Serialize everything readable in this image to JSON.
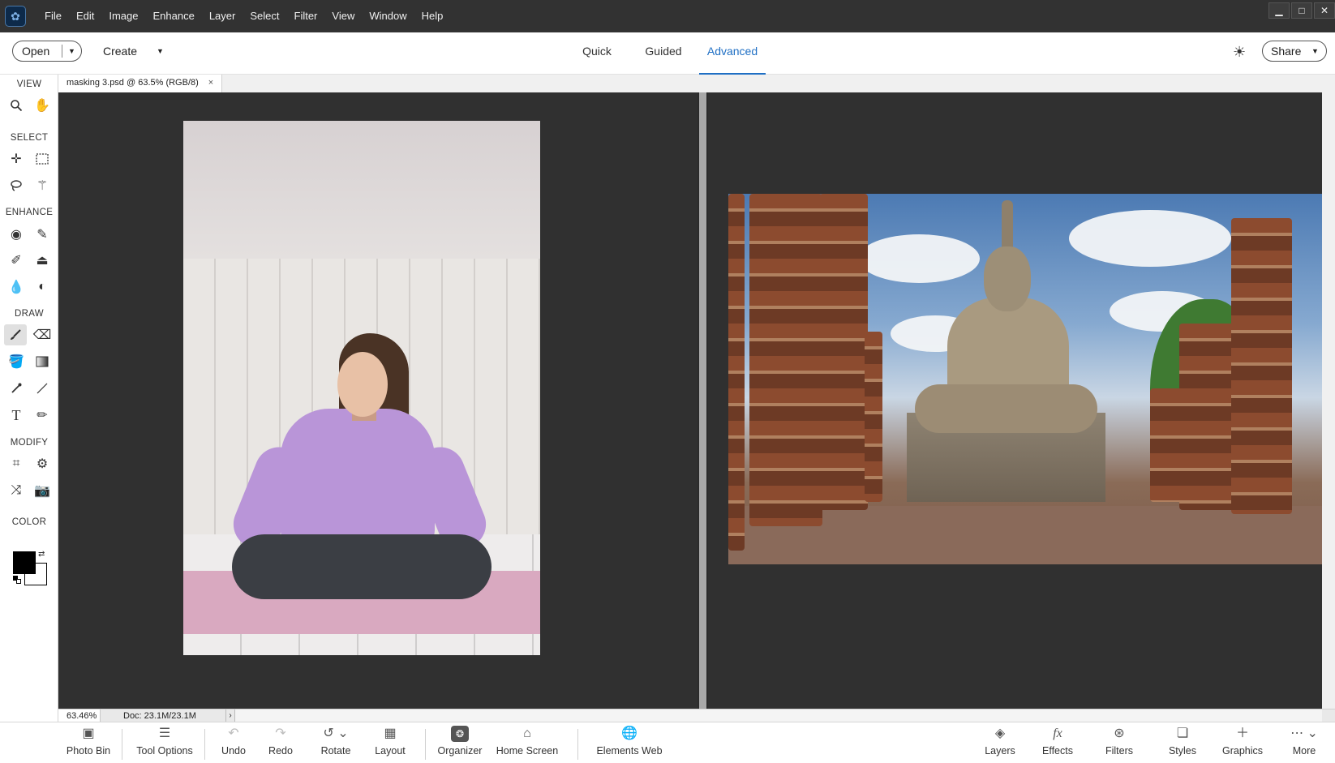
{
  "menubar": {
    "items": [
      "File",
      "Edit",
      "Image",
      "Enhance",
      "Layer",
      "Select",
      "Filter",
      "View",
      "Window",
      "Help"
    ]
  },
  "topbar": {
    "open_label": "Open",
    "create_label": "Create",
    "modes": [
      "Quick",
      "Guided",
      "Advanced"
    ],
    "active_mode": "Advanced",
    "share_label": "Share"
  },
  "toolbox": {
    "sections": [
      "VIEW",
      "SELECT",
      "ENHANCE",
      "DRAW",
      "MODIFY",
      "COLOR"
    ],
    "foreground_color": "#000000",
    "background_color": "#ffffff"
  },
  "document": {
    "tab_title": "masking 3.psd @ 63.5% (RGB/8)",
    "tab_close": "×"
  },
  "status": {
    "zoom": "63.46%",
    "doc_info": "Doc: 23.1M/23.1M",
    "arrow": "›"
  },
  "taskbar": {
    "left_items": [
      "Photo Bin",
      "Tool Options",
      "Undo",
      "Redo",
      "Rotate",
      "Layout",
      "Organizer",
      "Home Screen",
      "Elements Web"
    ],
    "right_items": [
      "Layers",
      "Effects",
      "Filters",
      "Styles",
      "Graphics",
      "More"
    ]
  },
  "colors": {
    "accent": "#1f6fc4",
    "menubar_bg": "#323232",
    "canvas_bg": "#303030"
  }
}
